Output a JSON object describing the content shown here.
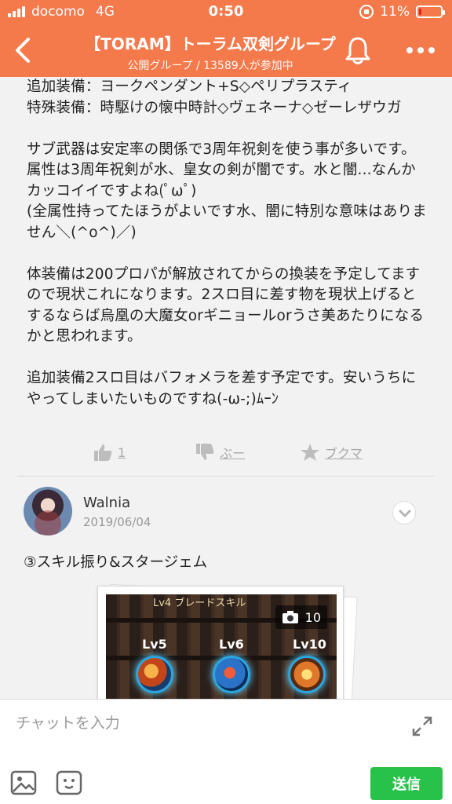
{
  "status_bar": {
    "carrier": "docomo",
    "network": "4G",
    "time": "0:50",
    "battery": "11%",
    "battery_level": 0.11
  },
  "header": {
    "title": "【TORAM】トーラム双剣グループ",
    "subtitle": "公開グループ / 13589人が参加中"
  },
  "post": {
    "text": "追加装備：ヨークペンダント+S◇ペリプラスティ\n特殊装備：時駆けの懐中時計◇ヴェネーナ◇ゼーレザウガ\n\nサブ武器は安定率の関係で3周年祝剣を使う事が多いです。属性は3周年祝剣が水、皇女の剣が闇です。水と闇...なんかカッコイイですよね(ﾟωﾟ)\n(全属性持ってたほうがよいです水、闇に特別な意味はありません＼(^o^)／)\n\n体装備は200プロパが解放されてからの換装を予定してますので現状これになります。2スロ目に差す物を現状上げるとするならば烏凰の大魔女orギニョールorうさ美あたりになるかと思われます。\n\n追加装備2スロ目はバフォメラを差す予定です。安いうちにやってしまいたいものですね(-ω-;)ﾑｰﾝ",
    "like_count": "1",
    "dislike_label": "ぶー",
    "bookmark_label": "ブクマ"
  },
  "comment": {
    "author": "Walnia",
    "date": "2019/06/04",
    "text": "③スキル振り&スタージェム",
    "photo": {
      "count": "10",
      "top_label": "Lv4 ブレードスキル",
      "levels": [
        "Lv5",
        "Lv6",
        "Lv10"
      ]
    }
  },
  "input_bar": {
    "placeholder": "チャットを入力",
    "send_label": "送信"
  },
  "colors": {
    "header_bg": "#f47a4c",
    "send_bg": "#28c24a"
  }
}
